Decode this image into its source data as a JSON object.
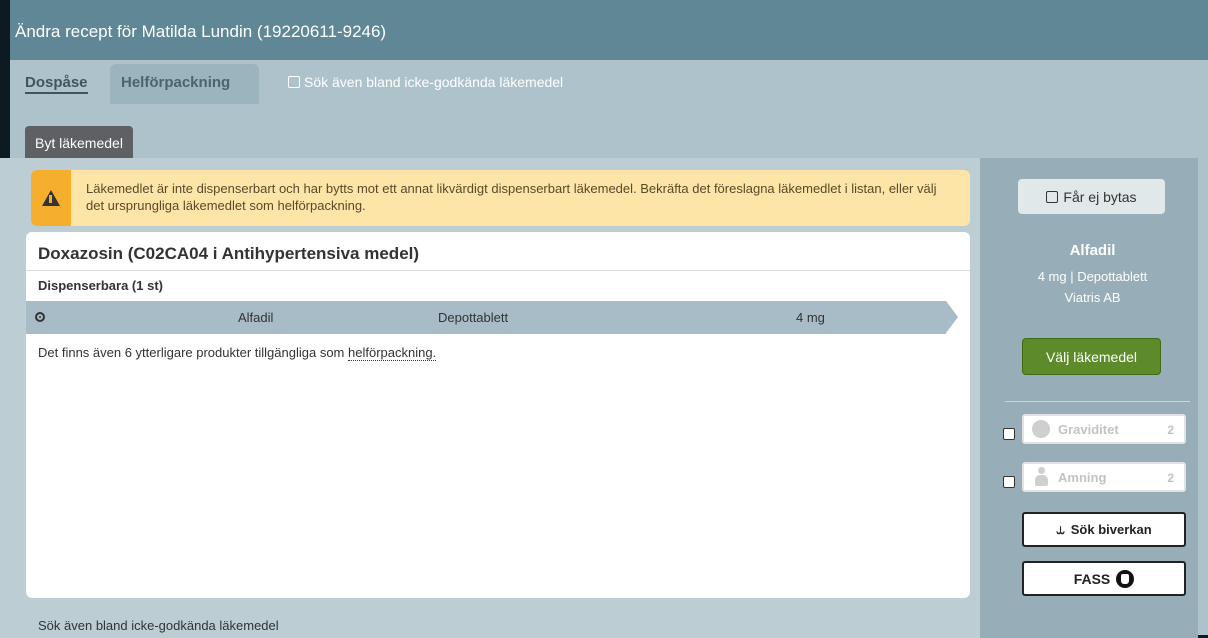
{
  "window": {
    "title": "Ändra recept för Matilda Lundin (19220611-9246)"
  },
  "tabs": [
    {
      "label": "Dospåse",
      "active": true
    },
    {
      "label": "Helförpackning",
      "active": false
    }
  ],
  "search_unapproved": {
    "label": "Sök även bland icke-godkända läkemedel",
    "checked": false
  },
  "byt_button": {
    "label": "Byt läkemedel"
  },
  "warning": {
    "text": "Läkemedlet är inte dispenserbart och har bytts mot ett annat likvärdigt dispenserbart läkemedel. Bekräfta det föreslagna läkemedlet i listan, eller välj det ursprungliga läkemedlet som helförpackning.",
    "icon": "warning-icon",
    "color": "#fde4a7"
  },
  "panel": {
    "title": "Doxazosin (C02CA04 i Antihypertensiva medel)",
    "section": "Dispenserbara (1 st)",
    "rows": [
      {
        "selected": true,
        "name": "Alfadil",
        "form": "Depottablett",
        "strength": "4 mg"
      }
    ],
    "note_prefix": "Det finns även 6 ytterligare produkter tillgängliga som ",
    "note_link": "helförpackning."
  },
  "bottom": {
    "prefix": "Sök även bland ",
    "link": "icke-godkända läkemedel"
  },
  "sidebar": {
    "far_ej_bytas": {
      "label": "Får ej bytas",
      "checked": false
    },
    "product": {
      "name": "Alfadil",
      "detail": "4 mg | Depottablett",
      "company": "Viatris AB"
    },
    "valj_button": "Välj läkemedel",
    "graviditet": {
      "label": "Graviditet",
      "count": "2"
    },
    "amning": {
      "label": "Amning",
      "count": "2"
    },
    "sok_biverkan": "Sök biverkan",
    "fass": "FASS",
    "accent_green": "#5d8b2a"
  }
}
